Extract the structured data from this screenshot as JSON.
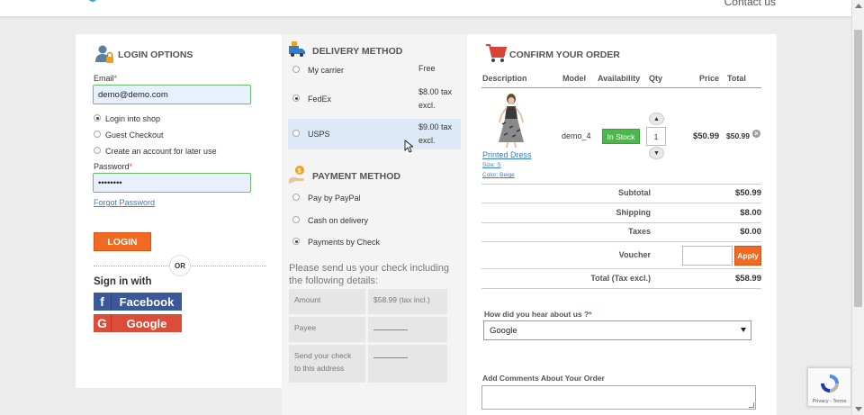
{
  "header": {
    "contact_label": "Contact us"
  },
  "login": {
    "title": "LOGIN OPTIONS",
    "email_label": "Email",
    "email_value": "demo@demo.com",
    "options": [
      "Login into shop",
      "Guest Checkout",
      "Create an account for later use"
    ],
    "selected_option": 0,
    "password_label": "Password",
    "password_value": "••••••••",
    "forgot_label": "Forgot Password",
    "login_button": "LOGIN",
    "or_label": "OR",
    "signin_with": "Sign in with",
    "facebook_label": "Facebook",
    "google_label": "Google",
    "required_mark": "*"
  },
  "delivery": {
    "title": "DELIVERY METHOD",
    "methods": [
      {
        "name": "My carrier",
        "price": "Free"
      },
      {
        "name": "FedEx",
        "price_line1": "$8.00 tax",
        "price_line2": "excl."
      },
      {
        "name": "USPS",
        "price_line1": "$9.00 tax",
        "price_line2": "excl."
      }
    ],
    "selected": 1,
    "hover": 2
  },
  "payment": {
    "title": "PAYMENT METHOD",
    "methods": [
      "Pay by PayPal",
      "Cash on delivery",
      "Payments by Check"
    ],
    "selected": 2,
    "note": "Please send us your check including the following details:",
    "table": {
      "amount_label": "Amount",
      "amount_value": "$58.99 (tax incl.)",
      "payee_label": "Payee",
      "send_label_1": "Send your check",
      "send_label_2": "to this address"
    }
  },
  "order": {
    "title": "CONFIRM YOUR ORDER",
    "columns": [
      "Description",
      "Model",
      "Availability",
      "Qty",
      "Price",
      "Total"
    ],
    "item": {
      "name": "Printed Dress",
      "size": "Size: S",
      "color": "Color: Beige",
      "model": "demo_4",
      "availability": "In Stock",
      "qty": "1",
      "price": "$50.99",
      "total": "$50.99",
      "remove_icon": "×"
    },
    "totals": {
      "subtotal_label": "Subtotal",
      "subtotal": "$50.99",
      "shipping_label": "Shipping",
      "shipping": "$8.00",
      "taxes_label": "Taxes",
      "taxes": "$0.00",
      "voucher_label": "Voucher",
      "apply_label": "Apply",
      "total_label": "Total (Tax excl.)",
      "total": "$58.99"
    },
    "hear_label": "How did you hear about us ?",
    "hear_value": "Google",
    "comments_label": "Add Comments About Your Order"
  },
  "recaptcha": {
    "text": "Privacy - Terms"
  },
  "colors": {
    "accent": "#f06a23",
    "stock": "#4cb84c",
    "facebook": "#3b5998",
    "google": "#dd4b39",
    "link": "#3b7dc4"
  }
}
